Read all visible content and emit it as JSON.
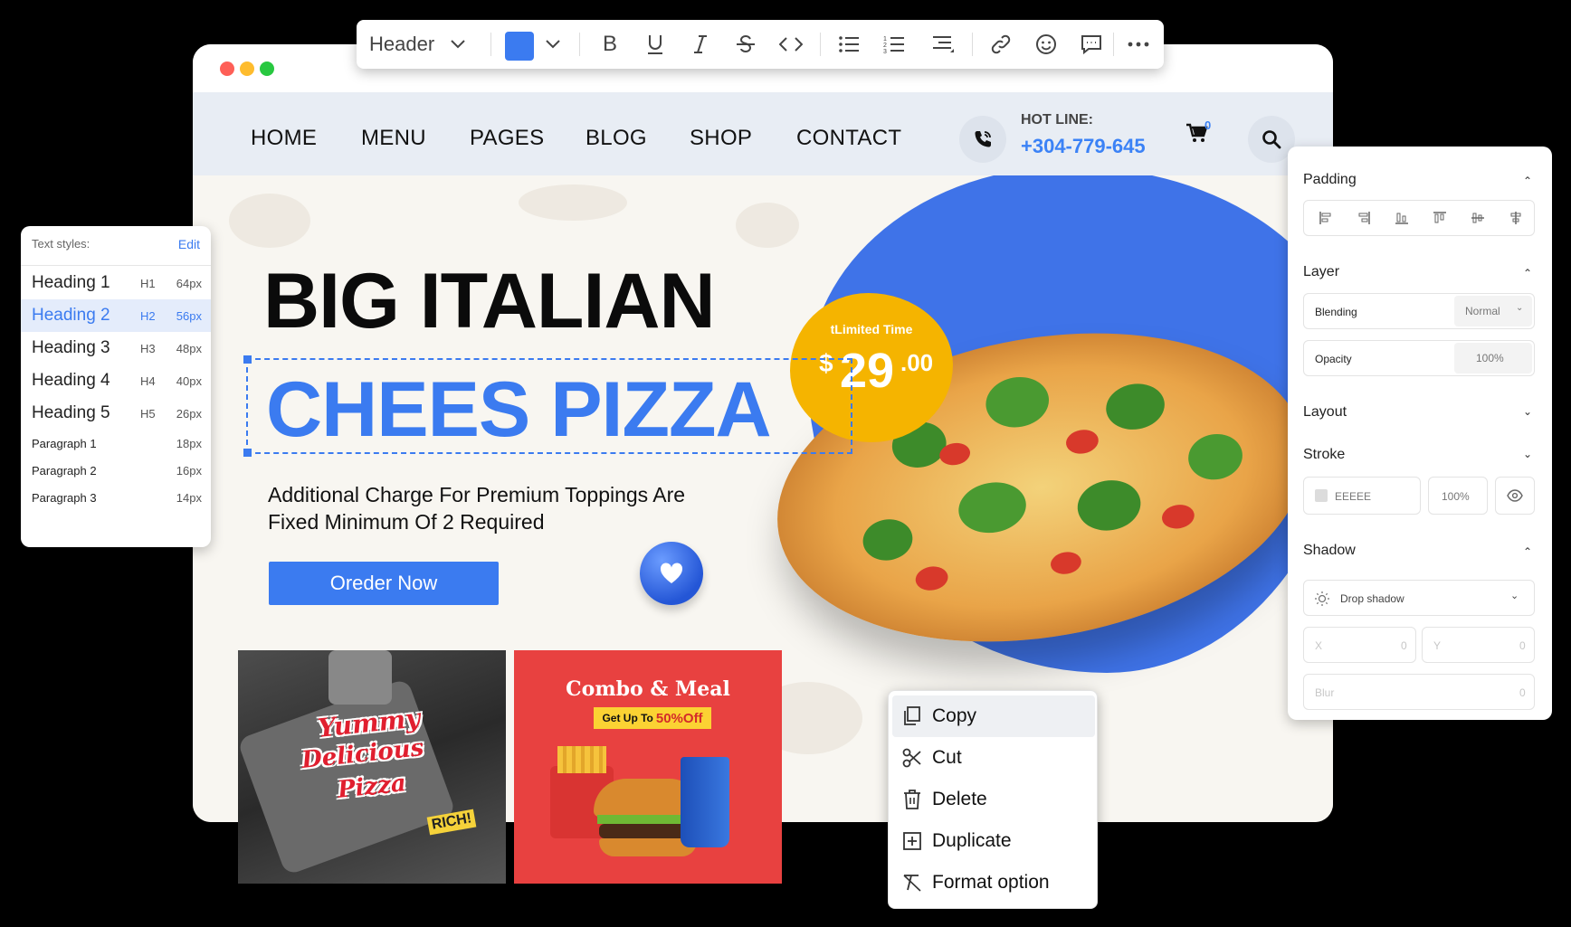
{
  "toolbar": {
    "style_select": "Header",
    "color": "#3b7bf0",
    "icons": [
      "chevron-down-icon",
      "bold-icon",
      "underline-icon",
      "italic-icon",
      "strikethrough-icon",
      "code-icon",
      "bullet-list-icon",
      "numbered-list-icon",
      "align-icon",
      "link-icon",
      "emoji-icon",
      "comment-icon",
      "more-icon"
    ]
  },
  "nav": {
    "items": [
      "HOME",
      "MENU",
      "PAGES",
      "BLOG",
      "SHOP",
      "CONTACT"
    ],
    "hotline_label": "HOT LINE:",
    "hotline_number": "+304-779-645",
    "cart_count": "0"
  },
  "hero": {
    "title_line1": "BIG ITALIAN",
    "title_line2": "CHEES PIZZA",
    "description": "Additional Charge For Premium Toppings Are Fixed Minimum Of 2 Required",
    "cta": "Oreder Now",
    "price_label": "tLimited Time",
    "price_currency": "$",
    "price_main": "29",
    "price_cents": ".00"
  },
  "cards": {
    "yummy": [
      "Yummy",
      "Delicious",
      "Pizza",
      "RICH!"
    ],
    "combo_title": "Combo & Meal",
    "combo_ribbon_prefix": "Get Up To",
    "combo_ribbon_value": "50%Off"
  },
  "text_styles": {
    "header": "Text styles:",
    "edit": "Edit",
    "rows": [
      {
        "name": "Heading 1",
        "tag": "H1",
        "size": "64px"
      },
      {
        "name": "Heading 2",
        "tag": "H2",
        "size": "56px"
      },
      {
        "name": "Heading 3",
        "tag": "H3",
        "size": "48px"
      },
      {
        "name": "Heading 4",
        "tag": "H4",
        "size": "40px"
      },
      {
        "name": "Heading 5",
        "tag": "H5",
        "size": "26px"
      },
      {
        "name": "Paragraph 1",
        "tag": "",
        "size": "18px"
      },
      {
        "name": "Paragraph 2",
        "tag": "",
        "size": "16px"
      },
      {
        "name": "Paragraph 3",
        "tag": "",
        "size": "14px"
      }
    ],
    "active_index": 1
  },
  "props": {
    "padding": "Padding",
    "layer": "Layer",
    "blending_label": "Blending",
    "blending_value": "Normal",
    "opacity_label": "Opacity",
    "opacity_value": "100%",
    "layout": "Layout",
    "stroke": "Stroke",
    "stroke_color": "EEEEE",
    "stroke_opacity": "100%",
    "shadow": "Shadow",
    "shadow_type": "Drop shadow",
    "x_label": "X",
    "x_value": "0",
    "y_label": "Y",
    "y_value": "0",
    "blur_label": "Blur",
    "blur_value": "0"
  },
  "context_menu": {
    "items": [
      "Copy",
      "Cut",
      "Delete",
      "Duplicate",
      "Format option"
    ]
  }
}
